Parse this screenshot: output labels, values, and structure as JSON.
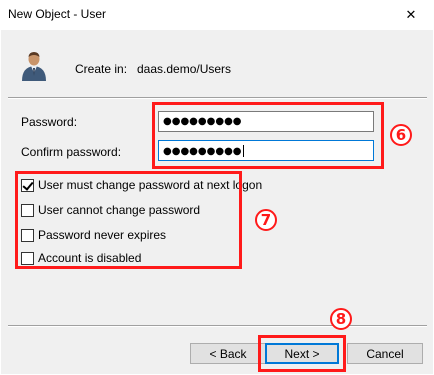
{
  "window": {
    "title": "New Object - User",
    "close_glyph": "✕"
  },
  "header": {
    "create_in_label": "Create in:",
    "create_in_path": "daas.demo/Users",
    "icon": "user-icon"
  },
  "password": {
    "label": "Password:",
    "value": "●●●●●●●●●"
  },
  "confirm_password": {
    "label": "Confirm password:",
    "value": "●●●●●●●●●"
  },
  "options": [
    {
      "label": "User must change password at next logon",
      "checked": true
    },
    {
      "label": "User cannot change password",
      "checked": false
    },
    {
      "label": "Password never expires",
      "checked": false
    },
    {
      "label": "Account is disabled",
      "checked": false
    }
  ],
  "buttons": {
    "back": "< Back",
    "next": "Next >",
    "cancel": "Cancel"
  },
  "annotations": {
    "m6": "6",
    "m7": "7",
    "m8": "8",
    "color": "#ff1a1a"
  }
}
